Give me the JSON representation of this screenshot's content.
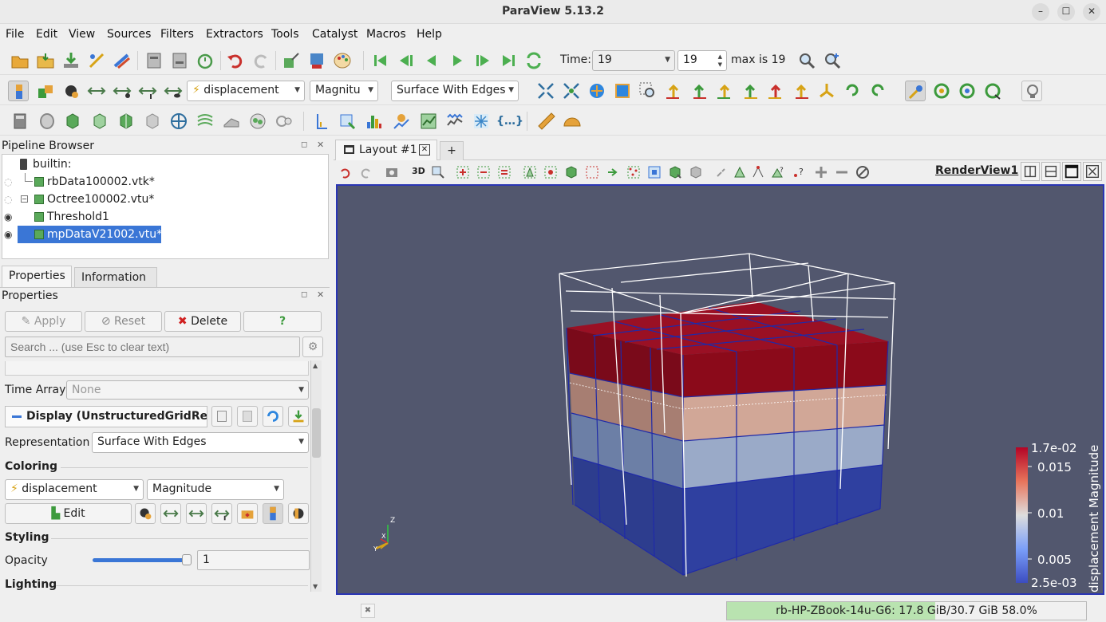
{
  "window": {
    "title": "ParaView 5.13.2",
    "minimize": "–",
    "maximize": "☐",
    "close": "✕"
  },
  "menu": [
    "File",
    "Edit",
    "View",
    "Sources",
    "Filters",
    "Extractors",
    "Tools",
    "Catalyst",
    "Macros",
    "Help"
  ],
  "time": {
    "label": "Time:",
    "value": "19",
    "index": "19",
    "max_label": "max is 19"
  },
  "display_toolbar": {
    "array": "displacement",
    "component": "Magnitu",
    "representation": "Surface With Edges"
  },
  "pipeline": {
    "title": "Pipeline Browser",
    "items": [
      {
        "name": "builtin:",
        "visible": null
      },
      {
        "name": "rbData100002.vtk*",
        "visible": false
      },
      {
        "name": "Octree100002.vtu*",
        "visible": false
      },
      {
        "name": "Threshold1",
        "visible": true
      },
      {
        "name": "mpDataV21002.vtu*",
        "visible": true,
        "selected": true
      }
    ]
  },
  "tabs": {
    "properties": "Properties",
    "information": "Information"
  },
  "properties": {
    "title": "Properties",
    "apply": "Apply",
    "reset": "Reset",
    "delete": "Delete",
    "help": "?",
    "search_placeholder": "Search ... (use Esc to clear text)",
    "time_array_label": "Time Array",
    "time_array_value": "None",
    "display_header": "Display (UnstructuredGridRepr",
    "representation_label": "Representation",
    "representation_value": "Surface With Edges",
    "coloring_header": "Coloring",
    "coloring_array": "displacement",
    "coloring_component": "Magnitude",
    "edit": "Edit",
    "styling_header": "Styling",
    "opacity_label": "Opacity",
    "opacity_value": "1",
    "opacity_level": 1.0,
    "lighting_header": "Lighting"
  },
  "layout": {
    "tab": "Layout #1",
    "add": "+",
    "view_name": "RenderView1",
    "view_3d": "3D"
  },
  "colorbar": {
    "title": "displacement Magnitude",
    "labels": [
      "1.7e-02",
      "0.015",
      "0.01",
      "0.005",
      "2.5e-03"
    ]
  },
  "axes": {
    "x": "X",
    "y": "Y",
    "z": "Z"
  },
  "status": {
    "memory": "rb-HP-ZBook-14u-G6: 17.8 GiB/30.7 GiB 58.0%",
    "memory_fraction": 0.58
  },
  "colors": {
    "accent": "#3a76d6",
    "background": "#52576e",
    "high": "#8b0a1a",
    "low": "#2a3a8c"
  }
}
